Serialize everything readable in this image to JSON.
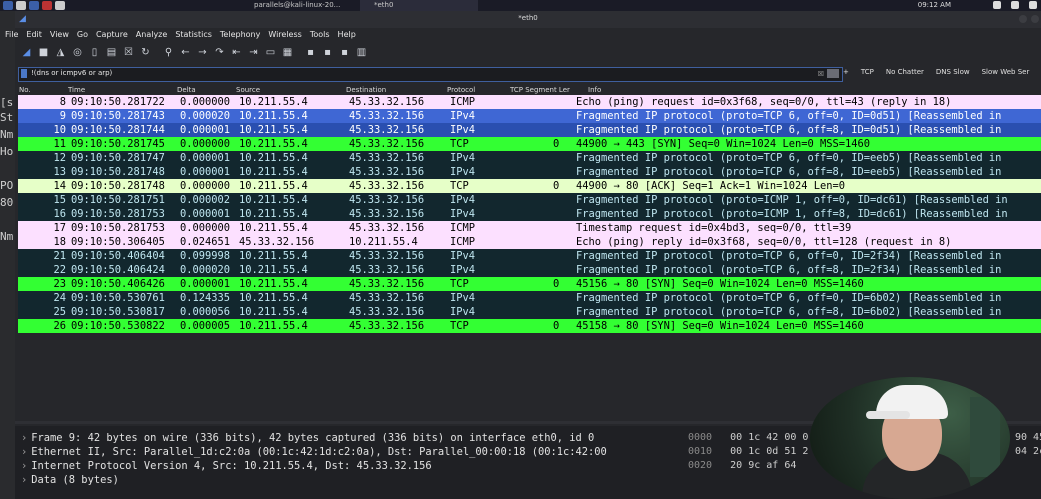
{
  "os_bar": {
    "tabs": [
      {
        "label": "parallels@kali-linux-20..."
      },
      {
        "label": "*eth0"
      }
    ],
    "clock": "09:12 AM"
  },
  "terminal_strip": [
    "[s",
    "St",
    "Nm",
    "Ho",
    "PO",
    "80",
    "Nm"
  ],
  "window": {
    "title": "*eth0",
    "menu": [
      "File",
      "Edit",
      "View",
      "Go",
      "Capture",
      "Analyze",
      "Statistics",
      "Telephony",
      "Wireless",
      "Tools",
      "Help"
    ],
    "toolbar_icons": [
      "shark-fin-icon",
      "stop-icon",
      "restart-icon",
      "options-icon",
      "open-icon",
      "save-icon",
      "close-file-icon",
      "reload-icon",
      "find-icon",
      "back-icon",
      "forward-icon",
      "goto-icon",
      "first-icon",
      "last-icon",
      "autoscroll-icon",
      "colorize-icon",
      "zoom-in-icon",
      "zoom-out-icon",
      "normal-size-icon",
      "resize-columns-icon"
    ]
  },
  "filter": {
    "value": "!(dns or icmpv6 or arp)",
    "buttons": [
      "TCP",
      "No Chatter",
      "DNS Slow",
      "Slow Web Ser"
    ]
  },
  "columns": [
    "No.",
    "Time",
    "Delta",
    "Source",
    "Destination",
    "Protocol",
    "TCP Segment Ler",
    "Info"
  ],
  "packets": [
    {
      "no": "8",
      "time": "09:10:50.281722",
      "delta": "0.000000",
      "src": "10.211.55.4",
      "dst": "45.33.32.156",
      "proto": "ICMP",
      "seglen": "",
      "info": "Echo (ping) request  id=0x3f68, seq=0/0, ttl=43 (reply in 18)",
      "style": "icmp"
    },
    {
      "no": "9",
      "time": "09:10:50.281743",
      "delta": "0.000020",
      "src": "10.211.55.4",
      "dst": "45.33.32.156",
      "proto": "IPv4",
      "seglen": "",
      "info": "Fragmented IP protocol (proto=TCP 6, off=0, ID=0d51) [Reassembled in",
      "style": "sel"
    },
    {
      "no": "10",
      "time": "09:10:50.281744",
      "delta": "0.000001",
      "src": "10.211.55.4",
      "dst": "45.33.32.156",
      "proto": "IPv4",
      "seglen": "",
      "info": "Fragmented IP protocol (proto=TCP 6, off=8, ID=0d51) [Reassembled in",
      "style": "sel2"
    },
    {
      "no": "11",
      "time": "09:10:50.281745",
      "delta": "0.000000",
      "src": "10.211.55.4",
      "dst": "45.33.32.156",
      "proto": "TCP",
      "seglen": "0",
      "info": "44900 → 443 [SYN] Seq=0 Win=1024 Len=0 MSS=1460",
      "style": "tcp"
    },
    {
      "no": "12",
      "time": "09:10:50.281747",
      "delta": "0.000001",
      "src": "10.211.55.4",
      "dst": "45.33.32.156",
      "proto": "IPv4",
      "seglen": "",
      "info": "Fragmented IP protocol (proto=TCP 6, off=0, ID=eeb5) [Reassembled in",
      "style": "ipv4"
    },
    {
      "no": "13",
      "time": "09:10:50.281748",
      "delta": "0.000001",
      "src": "10.211.55.4",
      "dst": "45.33.32.156",
      "proto": "IPv4",
      "seglen": "",
      "info": "Fragmented IP protocol (proto=TCP 6, off=8, ID=eeb5) [Reassembled in",
      "style": "ipv4"
    },
    {
      "no": "14",
      "time": "09:10:50.281748",
      "delta": "0.000000",
      "src": "10.211.55.4",
      "dst": "45.33.32.156",
      "proto": "TCP",
      "seglen": "0",
      "info": "44900 → 80 [ACK] Seq=1 Ack=1 Win=1024 Len=0",
      "style": "ack"
    },
    {
      "no": "15",
      "time": "09:10:50.281751",
      "delta": "0.000002",
      "src": "10.211.55.4",
      "dst": "45.33.32.156",
      "proto": "IPv4",
      "seglen": "",
      "info": "Fragmented IP protocol (proto=ICMP 1, off=0, ID=dc61) [Reassembled in",
      "style": "ipv4"
    },
    {
      "no": "16",
      "time": "09:10:50.281753",
      "delta": "0.000001",
      "src": "10.211.55.4",
      "dst": "45.33.32.156",
      "proto": "IPv4",
      "seglen": "",
      "info": "Fragmented IP protocol (proto=ICMP 1, off=8, ID=dc61) [Reassembled in",
      "style": "ipv4"
    },
    {
      "no": "17",
      "time": "09:10:50.281753",
      "delta": "0.000000",
      "src": "10.211.55.4",
      "dst": "45.33.32.156",
      "proto": "ICMP",
      "seglen": "",
      "info": "Timestamp request    id=0x4bd3, seq=0/0, ttl=39",
      "style": "icmp"
    },
    {
      "no": "18",
      "time": "09:10:50.306405",
      "delta": "0.024651",
      "src": "45.33.32.156",
      "dst": "10.211.55.4",
      "proto": "ICMP",
      "seglen": "",
      "info": "Echo (ping) reply    id=0x3f68, seq=0/0, ttl=128 (request in 8)",
      "style": "icmp"
    },
    {
      "no": "21",
      "time": "09:10:50.406404",
      "delta": "0.099998",
      "src": "10.211.55.4",
      "dst": "45.33.32.156",
      "proto": "IPv4",
      "seglen": "",
      "info": "Fragmented IP protocol (proto=TCP 6, off=0, ID=2f34) [Reassembled in",
      "style": "ipv4"
    },
    {
      "no": "22",
      "time": "09:10:50.406424",
      "delta": "0.000020",
      "src": "10.211.55.4",
      "dst": "45.33.32.156",
      "proto": "IPv4",
      "seglen": "",
      "info": "Fragmented IP protocol (proto=TCP 6, off=8, ID=2f34) [Reassembled in",
      "style": "ipv4"
    },
    {
      "no": "23",
      "time": "09:10:50.406426",
      "delta": "0.000001",
      "src": "10.211.55.4",
      "dst": "45.33.32.156",
      "proto": "TCP",
      "seglen": "0",
      "info": "45156 → 80 [SYN] Seq=0 Win=1024 Len=0 MSS=1460",
      "style": "tcp"
    },
    {
      "no": "24",
      "time": "09:10:50.530761",
      "delta": "0.124335",
      "src": "10.211.55.4",
      "dst": "45.33.32.156",
      "proto": "IPv4",
      "seglen": "",
      "info": "Fragmented IP protocol (proto=TCP 6, off=0, ID=6b02) [Reassembled in",
      "style": "ipv4"
    },
    {
      "no": "25",
      "time": "09:10:50.530817",
      "delta": "0.000056",
      "src": "10.211.55.4",
      "dst": "45.33.32.156",
      "proto": "IPv4",
      "seglen": "",
      "info": "Fragmented IP protocol (proto=TCP 6, off=8, ID=6b02) [Reassembled in",
      "style": "ipv4"
    },
    {
      "no": "26",
      "time": "09:10:50.530822",
      "delta": "0.000005",
      "src": "10.211.55.4",
      "dst": "45.33.32.156",
      "proto": "TCP",
      "seglen": "0",
      "info": "45158 → 80 [SYN] Seq=0 Win=1024 Len=0 MSS=1460",
      "style": "tcp"
    }
  ],
  "details": [
    "Frame 9: 42 bytes on wire (336 bits), 42 bytes captured (336 bits) on interface eth0, id 0",
    "Ethernet II, Src: Parallel_1d:c2:0a (00:1c:42:1d:c2:0a), Dst: Parallel_00:00:18 (00:1c:42:00",
    "Internet Protocol Version 4, Src: 10.211.55.4, Dst: 45.33.32.156",
    "Data (8 bytes)"
  ],
  "bytes": [
    {
      "offset": "0000",
      "hex": "00 1c 42 00 0",
      "tail": "90 45"
    },
    {
      "offset": "0010",
      "hex": "00 1c 0d 51 2",
      "tail": "04 2c"
    },
    {
      "offset": "0020",
      "hex": "20 9c af 64",
      "tail": ""
    }
  ]
}
